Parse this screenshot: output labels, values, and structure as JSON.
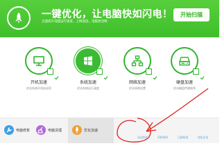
{
  "header": {
    "title": "一键优化，让电脑快如闪电！",
    "subtitle": "全面提升电脑运行速度，上网速度，电脑更流畅",
    "scan_button": "开始扫描",
    "background_color": "#46c431"
  },
  "features": [
    {
      "name": "开机加速",
      "desc": "优化系统开机启动项",
      "icon": "monitor-icon"
    },
    {
      "name": "系统加速",
      "desc": "优化系统运行速度",
      "icon": "windows-icon"
    },
    {
      "name": "网络加速",
      "desc": "优化网络设置",
      "icon": "network-icon"
    },
    {
      "name": "硬盘加速",
      "desc": "优化硬盘传输效率",
      "icon": "hard-drive-icon"
    }
  ],
  "footer": {
    "tabs": [
      {
        "label": "电脑修复",
        "icon": "wrench-icon",
        "color": "#3aa0e8"
      },
      {
        "label": "电脑清理",
        "icon": "broom-icon",
        "color": "#b06ad8"
      },
      {
        "label": "优化加速",
        "icon": "rocket-icon",
        "color": "#f0a030"
      }
    ],
    "status": [
      "自动优化",
      "开机时间",
      "已经有用",
      "优化方法"
    ]
  },
  "annotation": {
    "color": "#e0201c",
    "shape": "red-circle-with-arrow"
  }
}
